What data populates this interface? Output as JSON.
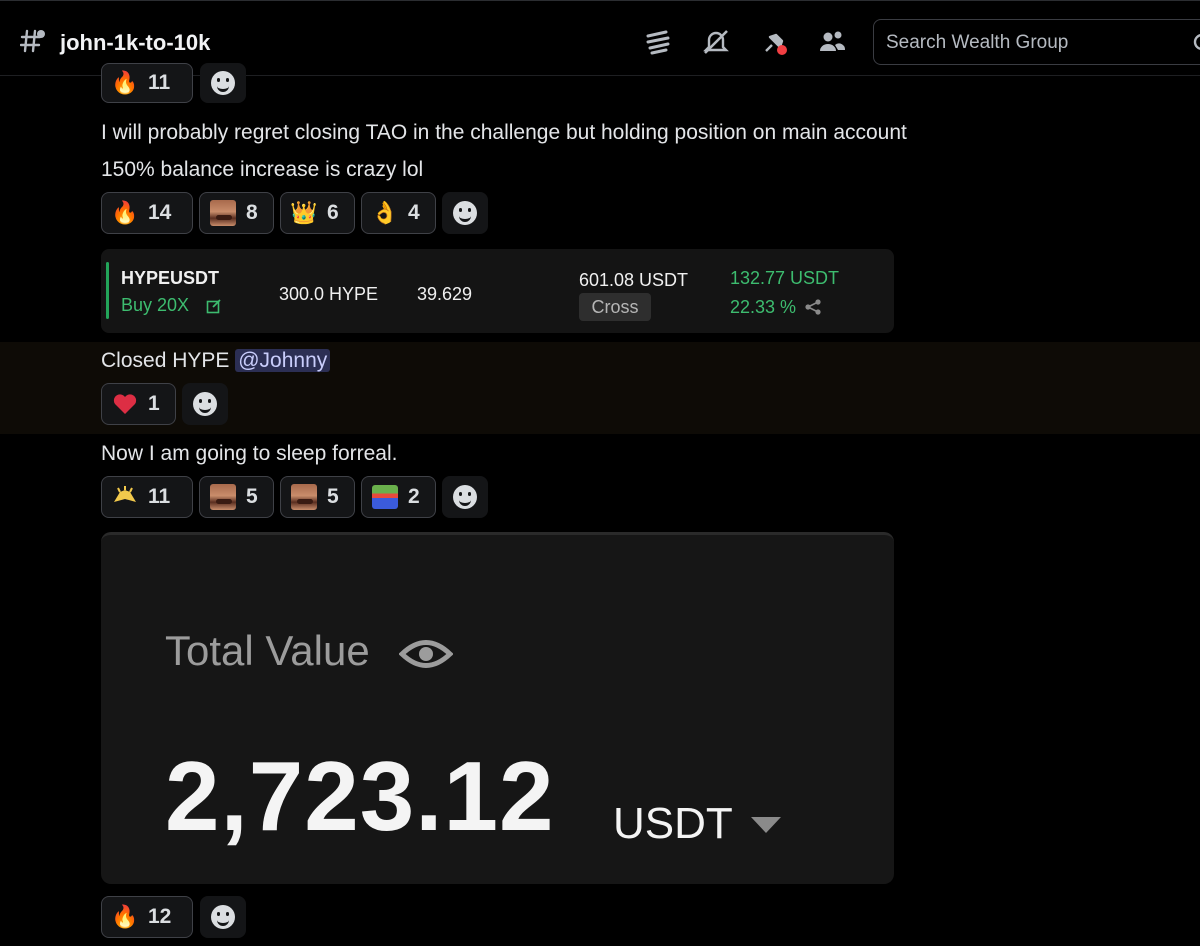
{
  "header": {
    "channel_name": "john-1k-to-10k",
    "icons": [
      "threads-icon",
      "notifications-muted-icon",
      "pinned-icon",
      "members-icon"
    ],
    "search_placeholder": "Search Wealth Group"
  },
  "messages": [
    {
      "id": "m0",
      "lines": [],
      "reactions": [
        {
          "emoji": "fire",
          "count": "11"
        }
      ]
    },
    {
      "id": "m1",
      "lines": [
        "I will probably regret closing TAO in the challenge but holding position on main account",
        "150% balance increase is crazy lol"
      ],
      "reactions": [
        {
          "emoji": "fire",
          "count": "14"
        },
        {
          "emoji": "laughing-man",
          "count": "8"
        },
        {
          "emoji": "crown",
          "count": "6"
        },
        {
          "emoji": "ok-hand",
          "count": "4"
        }
      ]
    },
    {
      "id": "m2",
      "position": {
        "symbol": "HYPEUSDT",
        "side": "Buy 20X",
        "size": "300.0 HYPE",
        "entry": "39.629",
        "margin": "601.08 USDT",
        "mode": "Cross",
        "pnl": "132.77 USDT",
        "pnl_pct": "22.33 %"
      }
    },
    {
      "id": "m3",
      "text": "Closed HYPE",
      "mention": "@Johnny",
      "reactions": [
        {
          "emoji": "heart",
          "count": "1"
        }
      ]
    },
    {
      "id": "m4",
      "text": "Now I am going to sleep forreal.",
      "reactions": [
        {
          "emoji": "salute-hands",
          "count": "11"
        },
        {
          "emoji": "laughing-man",
          "count": "5"
        },
        {
          "emoji": "laughing-man",
          "count": "5"
        },
        {
          "emoji": "pepe-flag",
          "count": "2"
        }
      ]
    },
    {
      "id": "m5",
      "total_value": {
        "label": "Total Value",
        "value": "2,723.12",
        "unit": "USDT"
      },
      "reactions": [
        {
          "emoji": "fire",
          "count": "12"
        }
      ]
    }
  ],
  "colors": {
    "background": "#000000",
    "card": "#141414",
    "green": "#3dbc6f",
    "mention_bg": "#2c2f54"
  }
}
